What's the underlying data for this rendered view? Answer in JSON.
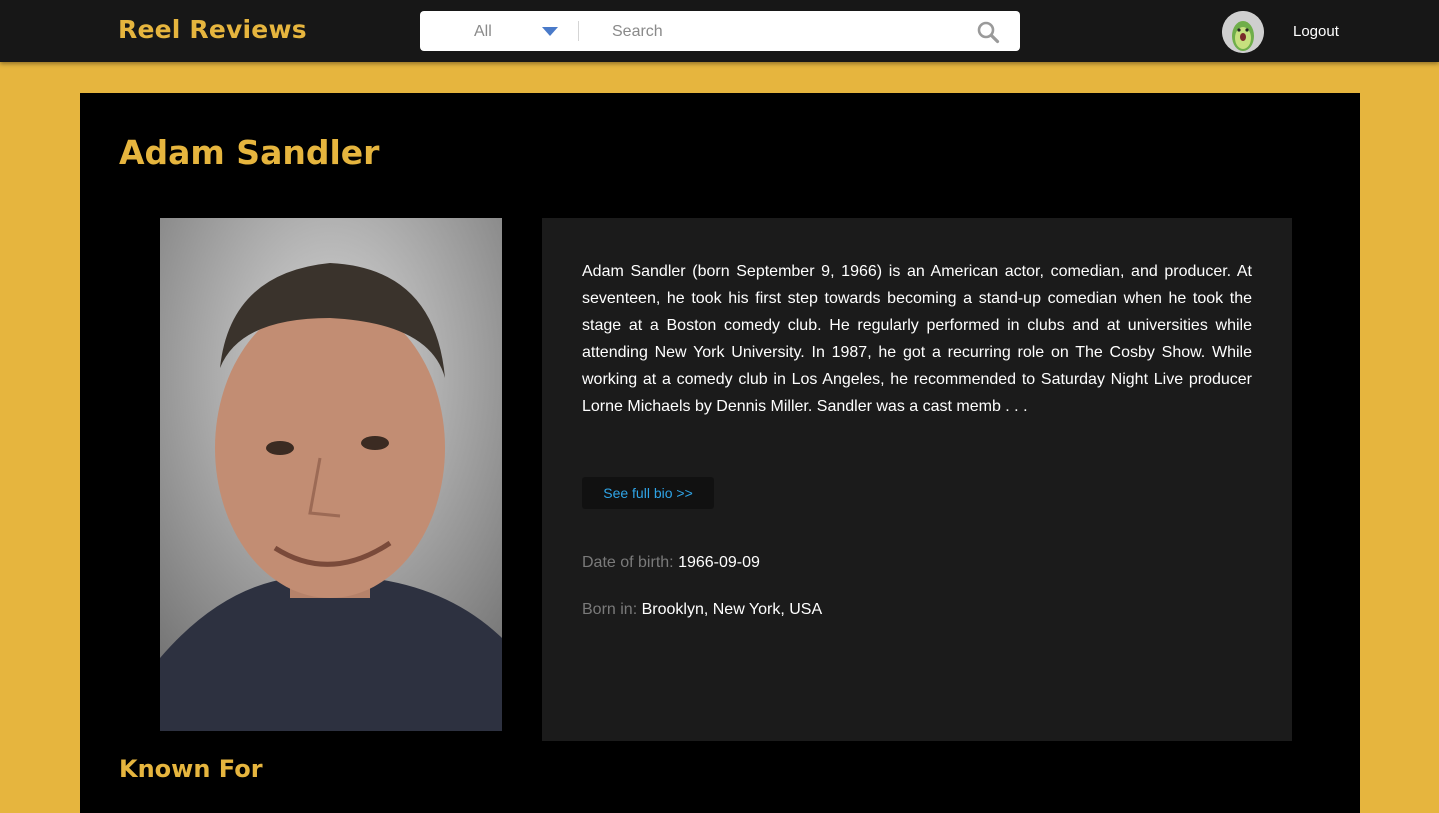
{
  "brand": {
    "name": "Reel Reviews",
    "accent_color": "#e6b53e"
  },
  "navbar": {
    "category_selected": "All",
    "search_placeholder": "Search",
    "search_icon": "search-icon",
    "avatar_icon": "avatar-icon",
    "logout_label": "Logout"
  },
  "person": {
    "name": "Adam Sandler",
    "bio": "Adam Sandler (born September 9, 1966) is an American actor, comedian, and producer. At seventeen, he took his first step towards becoming a stand-up comedian when he took the stage at a Boston comedy club. He regularly performed in clubs and at universities while attending New York University. In 1987, he got a recurring role on The Cosby Show. While working at a comedy club in Los Angeles, he recommended to Saturday Night Live producer Lorne Michaels by Dennis Miller. Sandler was a cast memb . . .",
    "see_full_bio_label": "See full bio >>",
    "dob_label": "Date of birth:",
    "dob_value": "1966-09-09",
    "birthplace_label": "Born in:",
    "birthplace_value": "Brooklyn, New York, USA"
  },
  "sections": {
    "known_for_title": "Known For"
  }
}
